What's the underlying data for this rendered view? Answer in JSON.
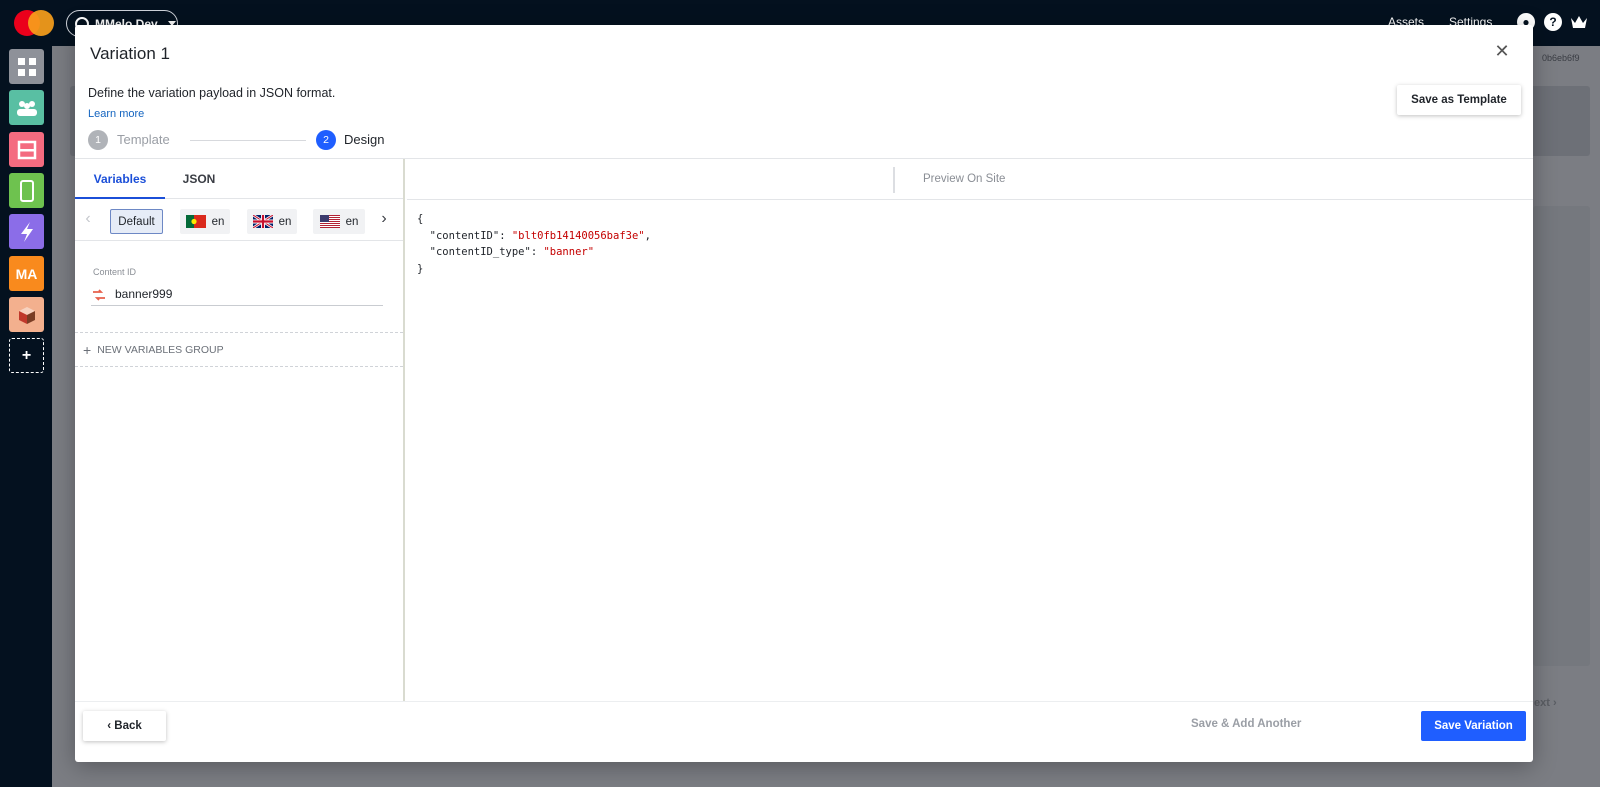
{
  "topbar": {
    "env_label": "MMelo Dev",
    "links": [
      "Assets",
      "Settings"
    ],
    "icons": [
      "user-icon",
      "help-icon",
      "crown-icon"
    ]
  },
  "background": {
    "id_fragment": "0b6eb6f9",
    "next_label": "ext ›"
  },
  "rail": {
    "items": [
      {
        "name": "dashboard-icon",
        "color": "#8e9199"
      },
      {
        "name": "audiences-icon",
        "color": "#59bfa3"
      },
      {
        "name": "layout-icon",
        "color": "#f46b80"
      },
      {
        "name": "mobile-icon",
        "color": "#6ec24f"
      },
      {
        "name": "bolt-icon",
        "color": "#8b6de8"
      },
      {
        "name": "ma-icon",
        "color": "#f98a1d",
        "label": "MA"
      },
      {
        "name": "box-icon",
        "color": "#f3b08e"
      },
      {
        "name": "add-icon",
        "label": "+"
      }
    ]
  },
  "modal": {
    "title": "Variation 1",
    "description": "Define the variation payload in JSON format.",
    "learn_more": "Learn more",
    "save_as_template": "Save as Template",
    "steps": [
      {
        "number": "1",
        "label": "Template"
      },
      {
        "number": "2",
        "label": "Design"
      }
    ],
    "tabs": [
      "Variables",
      "JSON"
    ],
    "locales": [
      {
        "label": "Default",
        "flag": "none"
      },
      {
        "label": "en",
        "flag": "portugal"
      },
      {
        "label": "en",
        "flag": "uk"
      },
      {
        "label": "en",
        "flag": "us"
      }
    ],
    "field": {
      "label": "Content ID",
      "value": "banner999"
    },
    "new_group": "NEW VARIABLES GROUP",
    "preview_on_site": "Preview On Site",
    "json": {
      "open": "{",
      "key1": "\"contentID\"",
      "val1": "\"blt0fb14140056baf3e\"",
      "key2": "\"contentID_type\"",
      "val2": "\"banner\"",
      "close": "}"
    },
    "footer": {
      "back": "Back",
      "save_add": "Save & Add Another",
      "save_variation": "Save Variation"
    }
  }
}
